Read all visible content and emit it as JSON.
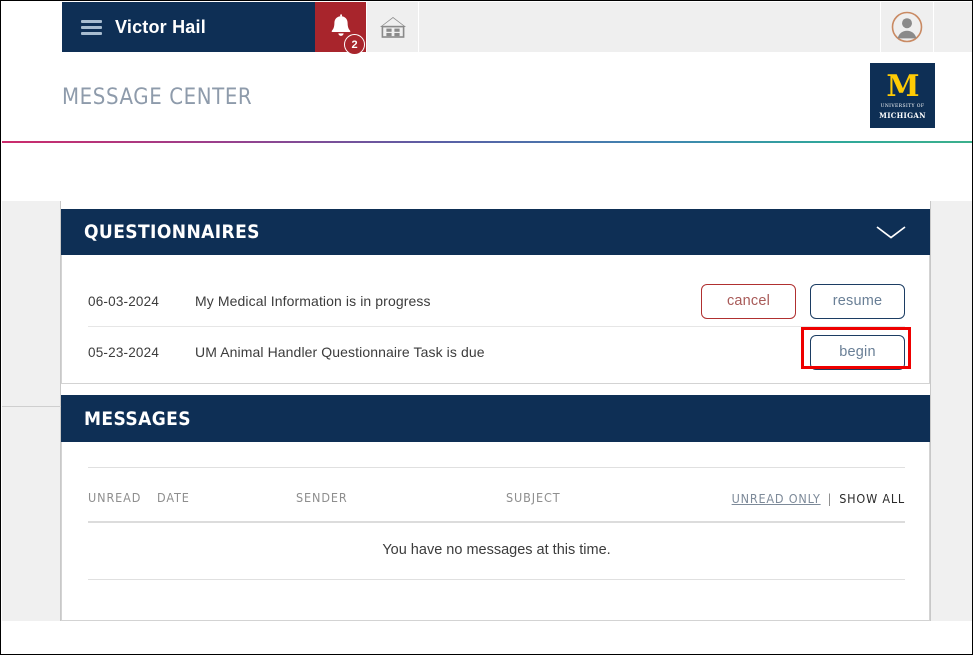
{
  "topbar": {
    "menu_icon": "hamburger-icon",
    "brand_name": "Victor Hail",
    "alerts_icon": "bell-icon",
    "alerts_count": "2",
    "home_icon": "home-icon",
    "avatar_icon": "user-avatar-icon"
  },
  "header": {
    "page_title": "MESSAGE CENTER",
    "logo": {
      "letter": "M",
      "line1": "UNIVERSITY OF",
      "line2": "MICHIGAN"
    }
  },
  "questionnaires": {
    "title": "QUESTIONNAIRES",
    "collapse_icon": "chevron-down-icon",
    "rows": [
      {
        "date": "06-03-2024",
        "text": "My Medical Information is in progress",
        "actions": [
          {
            "label": "cancel",
            "style": "cancel"
          },
          {
            "label": "resume",
            "style": "resume"
          }
        ]
      },
      {
        "date": "05-23-2024",
        "text": "UM Animal Handler Questionnaire Task is due",
        "actions": [
          {
            "label": "begin",
            "style": "begin"
          }
        ]
      }
    ]
  },
  "messages": {
    "title": "MESSAGES",
    "columns": {
      "unread": "UNREAD",
      "date": "DATE",
      "sender": "SENDER",
      "subject": "SUBJECT"
    },
    "filters": {
      "unread_only": "UNREAD ONLY",
      "separator": "|",
      "show_all": "SHOW ALL"
    },
    "empty_text": "You have no messages at this time.",
    "rows": []
  },
  "colors": {
    "navy": "#0e2f55",
    "maize": "#ffcb05",
    "alert_red": "#a8252c",
    "highlight_red": "#ee0000",
    "panel_gray": "#f0f0f0"
  }
}
